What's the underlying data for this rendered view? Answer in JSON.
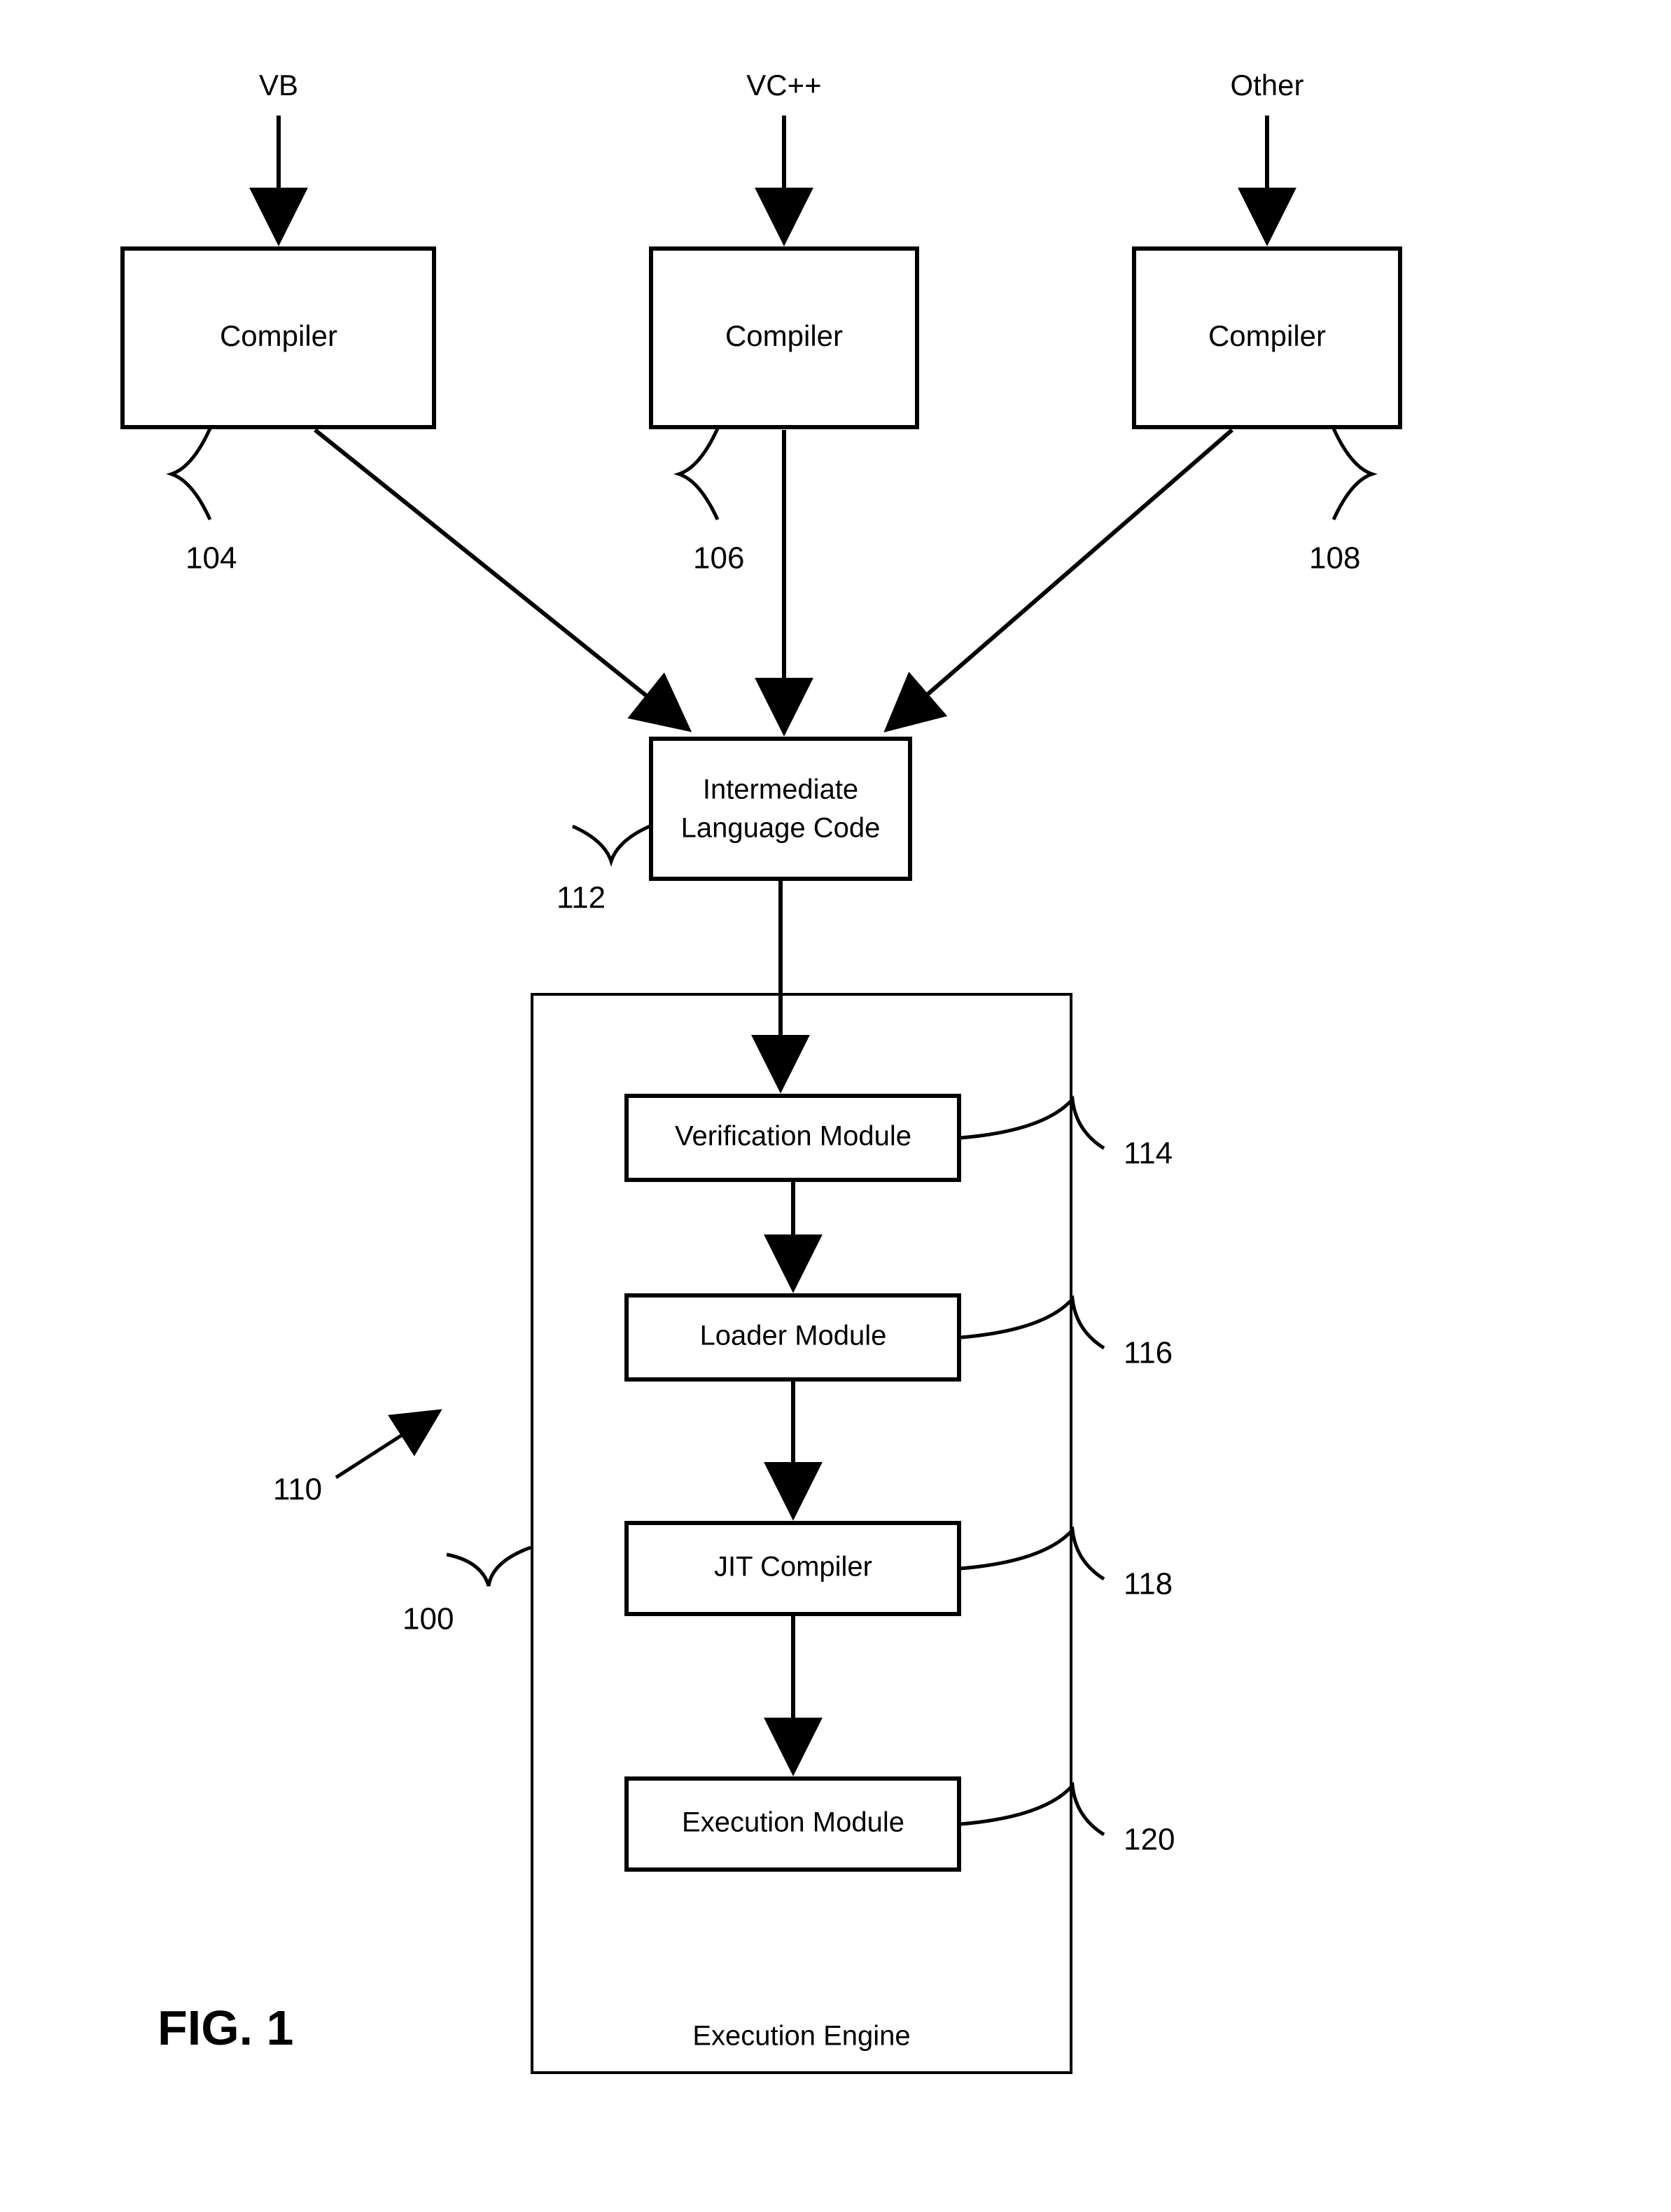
{
  "chart_data": {
    "type": "flowchart",
    "title": "FIG. 1",
    "nodes": [
      {
        "id": "vb_input",
        "label": "VB",
        "kind": "input"
      },
      {
        "id": "vcpp_input",
        "label": "VC++",
        "kind": "input"
      },
      {
        "id": "other_input",
        "label": "Other",
        "kind": "input"
      },
      {
        "id": "compiler_a",
        "label": "Compiler",
        "kind": "process",
        "ref": "104"
      },
      {
        "id": "compiler_b",
        "label": "Compiler",
        "kind": "process",
        "ref": "106"
      },
      {
        "id": "compiler_c",
        "label": "Compiler",
        "kind": "process",
        "ref": "108"
      },
      {
        "id": "ilc",
        "label_lines": [
          "Intermediate",
          "Language Code"
        ],
        "kind": "process",
        "ref": "112"
      },
      {
        "id": "engine",
        "label": "Execution Engine",
        "kind": "container",
        "refs": [
          "110",
          "100"
        ]
      },
      {
        "id": "verify",
        "label": "Verification Module",
        "kind": "process",
        "ref": "114",
        "parent": "engine"
      },
      {
        "id": "loader",
        "label": "Loader Module",
        "kind": "process",
        "ref": "116",
        "parent": "engine"
      },
      {
        "id": "jit",
        "label": "JIT Compiler",
        "kind": "process",
        "ref": "118",
        "parent": "engine"
      },
      {
        "id": "exec",
        "label": "Execution Module",
        "kind": "process",
        "ref": "120",
        "parent": "engine"
      }
    ],
    "edges": [
      {
        "from": "vb_input",
        "to": "compiler_a"
      },
      {
        "from": "vcpp_input",
        "to": "compiler_b"
      },
      {
        "from": "other_input",
        "to": "compiler_c"
      },
      {
        "from": "compiler_a",
        "to": "ilc"
      },
      {
        "from": "compiler_b",
        "to": "ilc"
      },
      {
        "from": "compiler_c",
        "to": "ilc"
      },
      {
        "from": "ilc",
        "to": "verify"
      },
      {
        "from": "verify",
        "to": "loader"
      },
      {
        "from": "loader",
        "to": "jit"
      },
      {
        "from": "jit",
        "to": "exec"
      }
    ]
  },
  "inputs": {
    "vb": "VB",
    "vcpp": "VC++",
    "other": "Other"
  },
  "compilers": {
    "a": "Compiler",
    "b": "Compiler",
    "c": "Compiler"
  },
  "ilc": {
    "line1": "Intermediate",
    "line2": "Language Code"
  },
  "engine": {
    "title": "Execution Engine",
    "verify": "Verification Module",
    "loader": "Loader Module",
    "jit": "JIT Compiler",
    "exec": "Execution Module"
  },
  "refs": {
    "compiler_a": "104",
    "compiler_b": "106",
    "compiler_c": "108",
    "ilc": "112",
    "engine_outer": "110",
    "engine_inner": "100",
    "verify": "114",
    "loader": "116",
    "jit": "118",
    "exec": "120"
  },
  "figure": "FIG. 1"
}
